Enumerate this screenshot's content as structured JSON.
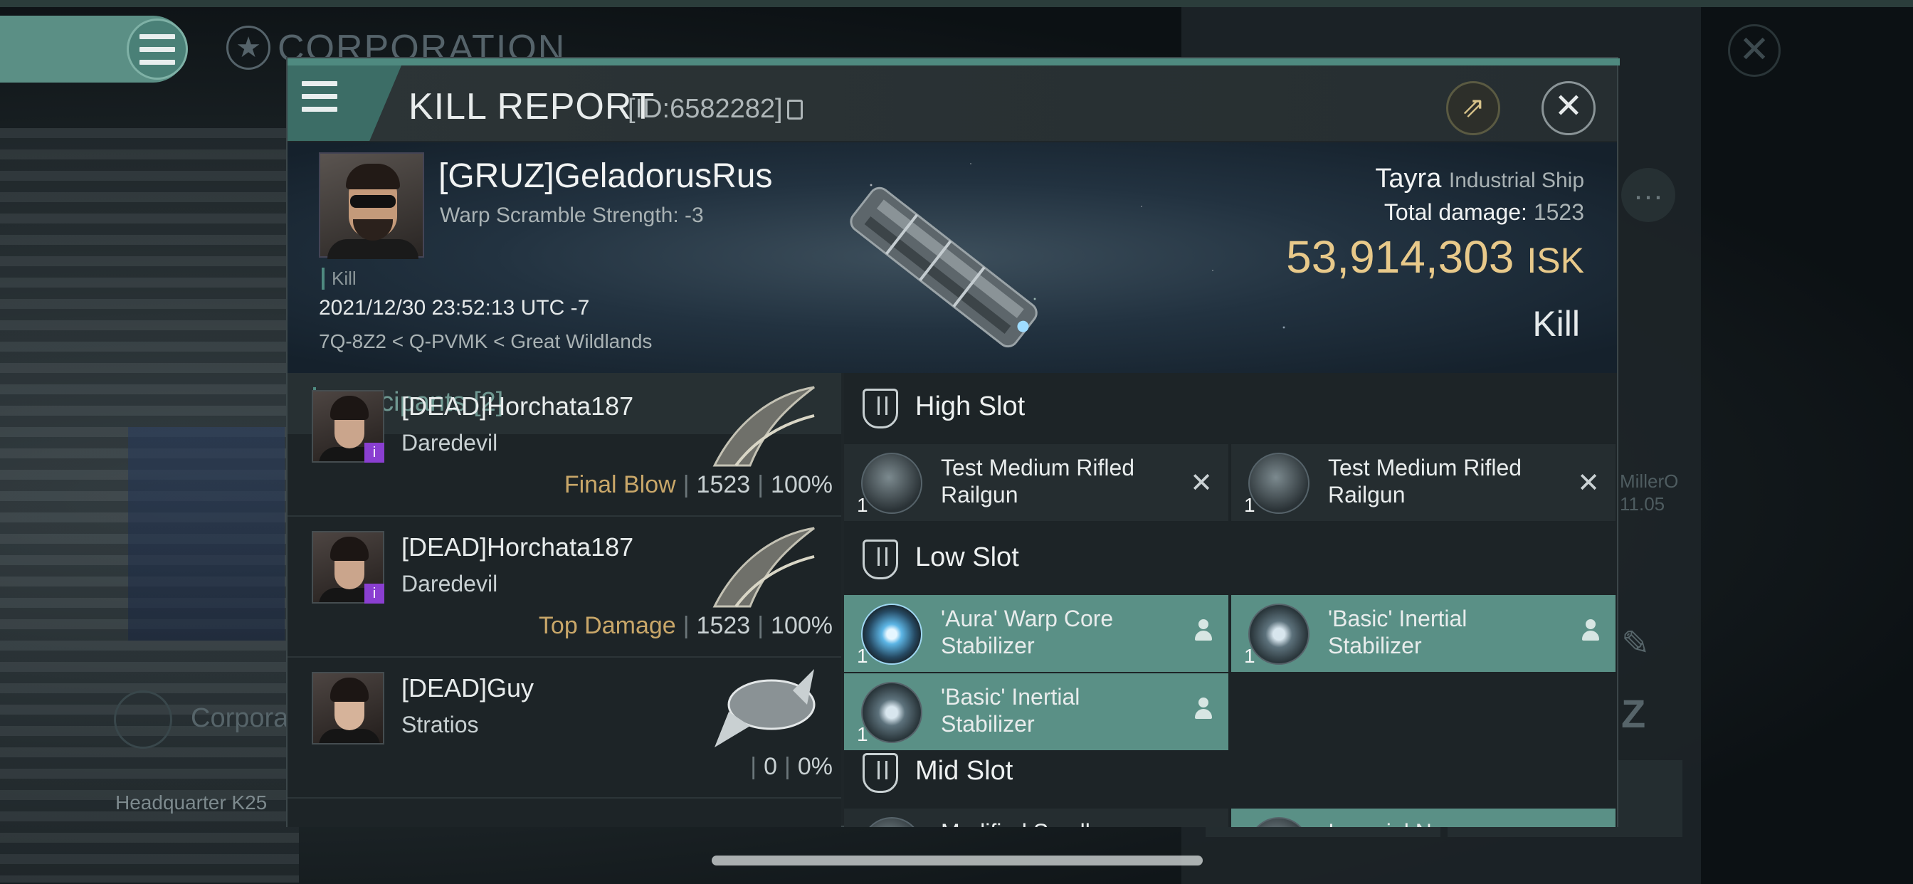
{
  "background": {
    "corp_title": "CORPORATION",
    "corp_label": "Corpora",
    "hq_label": "Headquarter K25",
    "side_text": [
      "MillerO",
      "11.05"
    ]
  },
  "header": {
    "title": "KILL REPORT",
    "id": "[ID:6582282]"
  },
  "victim": {
    "name": "[GRUZ]GeladorusRus",
    "warp_scramble": "Warp Scramble Strength: -3",
    "tag": "Kill",
    "datetime": "2021/12/30 23:52:13 UTC -7",
    "location": "7Q-8Z2 < Q-PVMK < Great Wildlands",
    "ship": "Tayra",
    "ship_class": "Industrial Ship",
    "total_damage_label": "Total damage:",
    "total_damage": "1523",
    "isk_value": "53,914,303",
    "isk_unit": "ISK",
    "result": "Kill"
  },
  "participants": {
    "title": "Participants",
    "count": "[2]",
    "rows": [
      {
        "name": "[DEAD]Horchata187",
        "ship": "Daredevil",
        "label": "Final Blow",
        "damage": "1523",
        "percent": "100%"
      },
      {
        "name": "[DEAD]Horchata187",
        "ship": "Daredevil",
        "label": "Top Damage",
        "damage": "1523",
        "percent": "100%"
      },
      {
        "name": "[DEAD]Guy",
        "ship": "Stratios",
        "label": "",
        "damage": "0",
        "percent": "0%"
      }
    ]
  },
  "fitting": {
    "high_slot": {
      "title": "High Slot",
      "modules": [
        {
          "name": "Test Medium Rifled Railgun",
          "qty": "1",
          "state": "destroyed"
        },
        {
          "name": "Test Medium Rifled Railgun",
          "qty": "1",
          "state": "destroyed"
        }
      ]
    },
    "low_slot": {
      "title": "Low Slot",
      "modules": [
        {
          "name": "'Aura' Warp Core Stabilizer",
          "qty": "1",
          "state": "dropped"
        },
        {
          "name": "'Basic' Inertial Stabilizer",
          "qty": "1",
          "state": "dropped"
        },
        {
          "name": "'Basic' Inertial Stabilizer",
          "qty": "1",
          "state": "dropped"
        }
      ]
    },
    "mid_slot": {
      "title": "Mid Slot",
      "modules": [
        {
          "name": "Modified Small",
          "qty": "",
          "state": "destroyed"
        },
        {
          "name": "Imperial Navy",
          "qty": "",
          "state": "dropped"
        }
      ]
    }
  },
  "colors": {
    "accent": "#4f8a80",
    "isk": "#e8c98a",
    "highlight_module": "#5a9086",
    "stat_label": "#c9a769"
  }
}
